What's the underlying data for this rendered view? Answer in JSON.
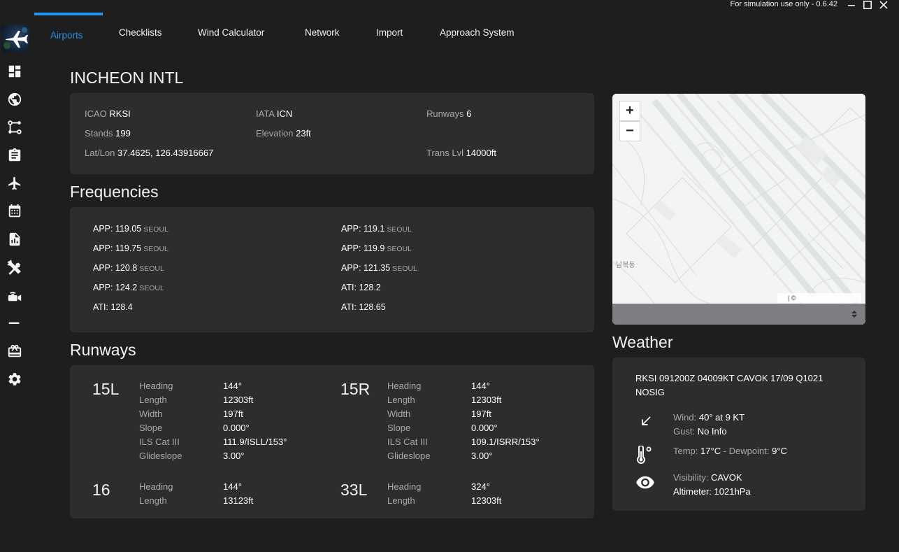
{
  "window": {
    "notice": "For simulation use only - 0.6.42"
  },
  "sidebar": {
    "icons": [
      "dashboard-icon",
      "globe-icon",
      "route-icon",
      "clipboard-icon",
      "plane-icon",
      "calendar-icon",
      "report-icon",
      "tools-icon",
      "broadcast-icon",
      "divider-icon",
      "gift-icon",
      "gear-icon"
    ]
  },
  "tabs": [
    {
      "label": "Airports",
      "active": true
    },
    {
      "label": "Checklists"
    },
    {
      "label": "Wind Calculator"
    },
    {
      "label": "Network"
    },
    {
      "label": "Import"
    },
    {
      "label": "Approach System"
    }
  ],
  "airport": {
    "name": "INCHEON INTL",
    "icao_label": "ICAO",
    "icao": "RKSI",
    "iata_label": "IATA",
    "iata": "ICN",
    "runways_label": "Runways",
    "runways": "6",
    "stands_label": "Stands",
    "stands": "199",
    "elevation_label": "Elevation",
    "elevation": "23ft",
    "latlon_label": "Lat/Lon",
    "latlon": "37.4625, 126.43916667",
    "translvl_label": "Trans Lvl",
    "translvl": "14000ft"
  },
  "frequencies": {
    "title": "Frequencies",
    "items": [
      {
        "freq": "APP: 119.05",
        "name": "SEOUL"
      },
      {
        "freq": "APP: 119.1",
        "name": "SEOUL"
      },
      {
        "freq": "APP: 119.75",
        "name": "SEOUL"
      },
      {
        "freq": "APP: 119.9",
        "name": "SEOUL"
      },
      {
        "freq": "APP: 120.8",
        "name": "SEOUL"
      },
      {
        "freq": "APP: 121.35",
        "name": "SEOUL"
      },
      {
        "freq": "APP: 124.2",
        "name": "SEOUL"
      },
      {
        "freq": "ATI: 128.2",
        "name": ""
      },
      {
        "freq": "ATI: 128.4",
        "name": ""
      },
      {
        "freq": "ATI: 128.65",
        "name": ""
      }
    ]
  },
  "runways": {
    "title": "Runways",
    "labels": {
      "heading": "Heading",
      "length": "Length",
      "width": "Width",
      "slope": "Slope",
      "ils": "ILS Cat III",
      "glideslope": "Glideslope"
    },
    "items": [
      {
        "name": "15L",
        "heading": "144°",
        "length": "12303ft",
        "width": "197ft",
        "slope": "0.000°",
        "ils": "111.9/ISLL/153°",
        "glideslope": "3.00°"
      },
      {
        "name": "15R",
        "heading": "144°",
        "length": "12303ft",
        "width": "197ft",
        "slope": "0.000°",
        "ils": "109.1/ISRR/153°",
        "glideslope": "3.00°"
      },
      {
        "name": "16",
        "heading": "144°",
        "length": "13123ft"
      },
      {
        "name": "33L",
        "heading": "324°",
        "length": "12303ft"
      }
    ]
  },
  "map": {
    "zoom_in": "+",
    "zoom_out": "−",
    "place_label": "남북동",
    "attribution": "| ©"
  },
  "weather": {
    "title": "Weather",
    "metar": "RKSI 091200Z 04009KT CAVOK 17/09 Q1021 NOSIG",
    "wind_label": "Wind:",
    "wind": "40° at 9 KT",
    "gust_label": "Gust:",
    "gust": "No Info",
    "temp_label": "Temp:",
    "temp": "17°C",
    "sep": "-",
    "dew_label": "Dewpoint:",
    "dew": "9°C",
    "vis_label": "Visibility:",
    "vis": "CAVOK",
    "alt_label": "Altimeter:",
    "alt": "1021hPa"
  }
}
